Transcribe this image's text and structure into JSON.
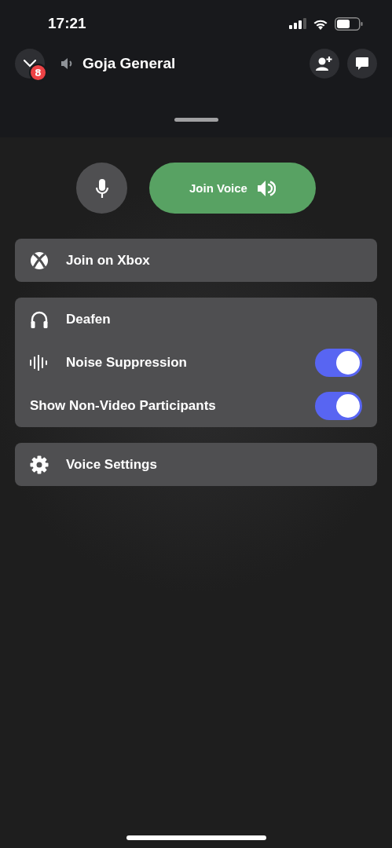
{
  "status_bar": {
    "time": "17:21"
  },
  "header": {
    "badge": "8",
    "title": "Goja General"
  },
  "voice_controls": {
    "mic_muted": false,
    "join_label": "Join Voice"
  },
  "groups": [
    {
      "items": [
        {
          "kind": "action",
          "label": "Join on Xbox"
        }
      ]
    },
    {
      "items": [
        {
          "kind": "action",
          "label": "Deafen"
        },
        {
          "kind": "toggle",
          "label": "Noise Suppression",
          "on": true
        },
        {
          "kind": "toggle",
          "label": "Show Non-Video Participants",
          "on": true
        }
      ]
    },
    {
      "items": [
        {
          "kind": "action",
          "label": "Voice Settings"
        }
      ]
    }
  ]
}
